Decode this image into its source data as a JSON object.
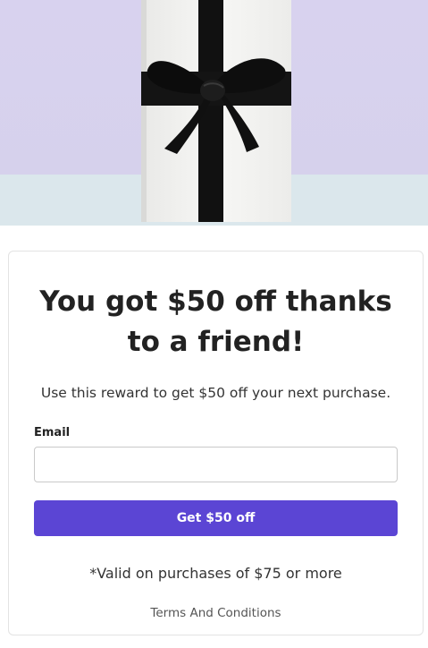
{
  "hero": {
    "image": "gift-box-black-ribbon-image",
    "colors": {
      "background": "#d9d3ee",
      "floor": "#dfe9ec",
      "box": "#f2f2f0",
      "ribbon": "#111111"
    }
  },
  "card": {
    "headline": "You got $50 off thanks to a friend!",
    "subtext": "Use this reward to get $50 off your next purchase.",
    "email": {
      "label": "Email",
      "value": "",
      "placeholder": ""
    },
    "cta_label": "Get $50 off",
    "validity_note": "*Valid on purchases of $75 or more",
    "terms_link": "Terms And Conditions"
  },
  "colors": {
    "accent": "#5b45d4",
    "border": "#e3e3e3"
  }
}
